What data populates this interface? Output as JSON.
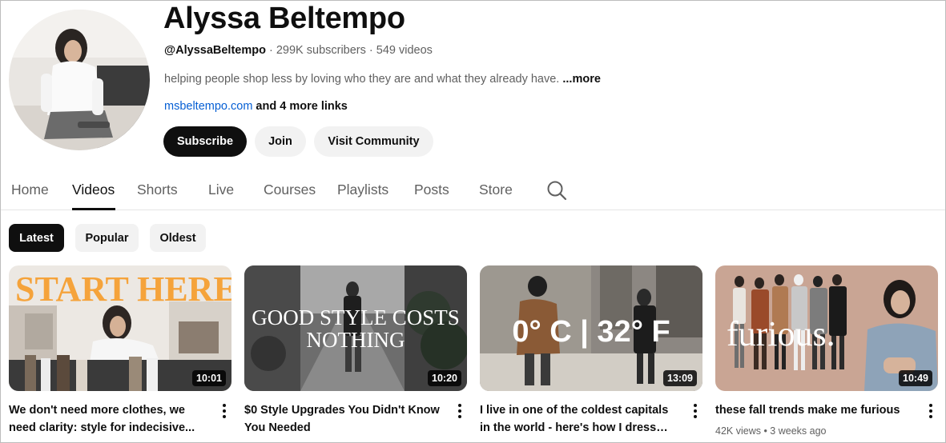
{
  "channel": {
    "name": "Alyssa Beltempo",
    "handle": "@AlyssaBeltempo",
    "separator": " · ",
    "subscribers": "299K subscribers",
    "videos": "549 videos",
    "description": "helping people shop less by loving who they are and what they already have.",
    "description_more": " ...more",
    "link_url": "msbeltempo.com",
    "more_links": " and 4 more links"
  },
  "actions": {
    "subscribe": "Subscribe",
    "join": "Join",
    "visit_community": "Visit Community"
  },
  "tabs": [
    "Home",
    "Videos",
    "Shorts",
    "Live",
    "Courses",
    "Playlists",
    "Posts",
    "Store"
  ],
  "active_tab": "Videos",
  "chips": [
    "Latest",
    "Popular",
    "Oldest"
  ],
  "active_chip": "Latest",
  "videos": [
    {
      "title": "We don't need more clothes, we need clarity: style for indecisive...",
      "duration": "10:01",
      "thumb_text": "START HERE.",
      "stats": ""
    },
    {
      "title": "$0 Style Upgrades You Didn't Know You Needed",
      "duration": "10:20",
      "thumb_text": "GOOD STYLE COSTS NOTHING",
      "stats": ""
    },
    {
      "title": "I live in one of the coldest capitals in the world - here's how I dress well i...",
      "duration": "13:09",
      "thumb_text": "0° C | 32° F",
      "stats": ""
    },
    {
      "title": "these fall trends make me furious",
      "duration": "10:49",
      "thumb_text": "furious.",
      "stats": "42K views • 3 weeks ago"
    }
  ],
  "icons": {
    "search": "search-icon",
    "more": "more-vert-icon"
  },
  "colors": {
    "primary_text": "#0f0f0f",
    "secondary_text": "#606060",
    "link": "#065fd4",
    "chip_bg": "#f2f2f2",
    "accent_orange": "#f5a33b"
  }
}
